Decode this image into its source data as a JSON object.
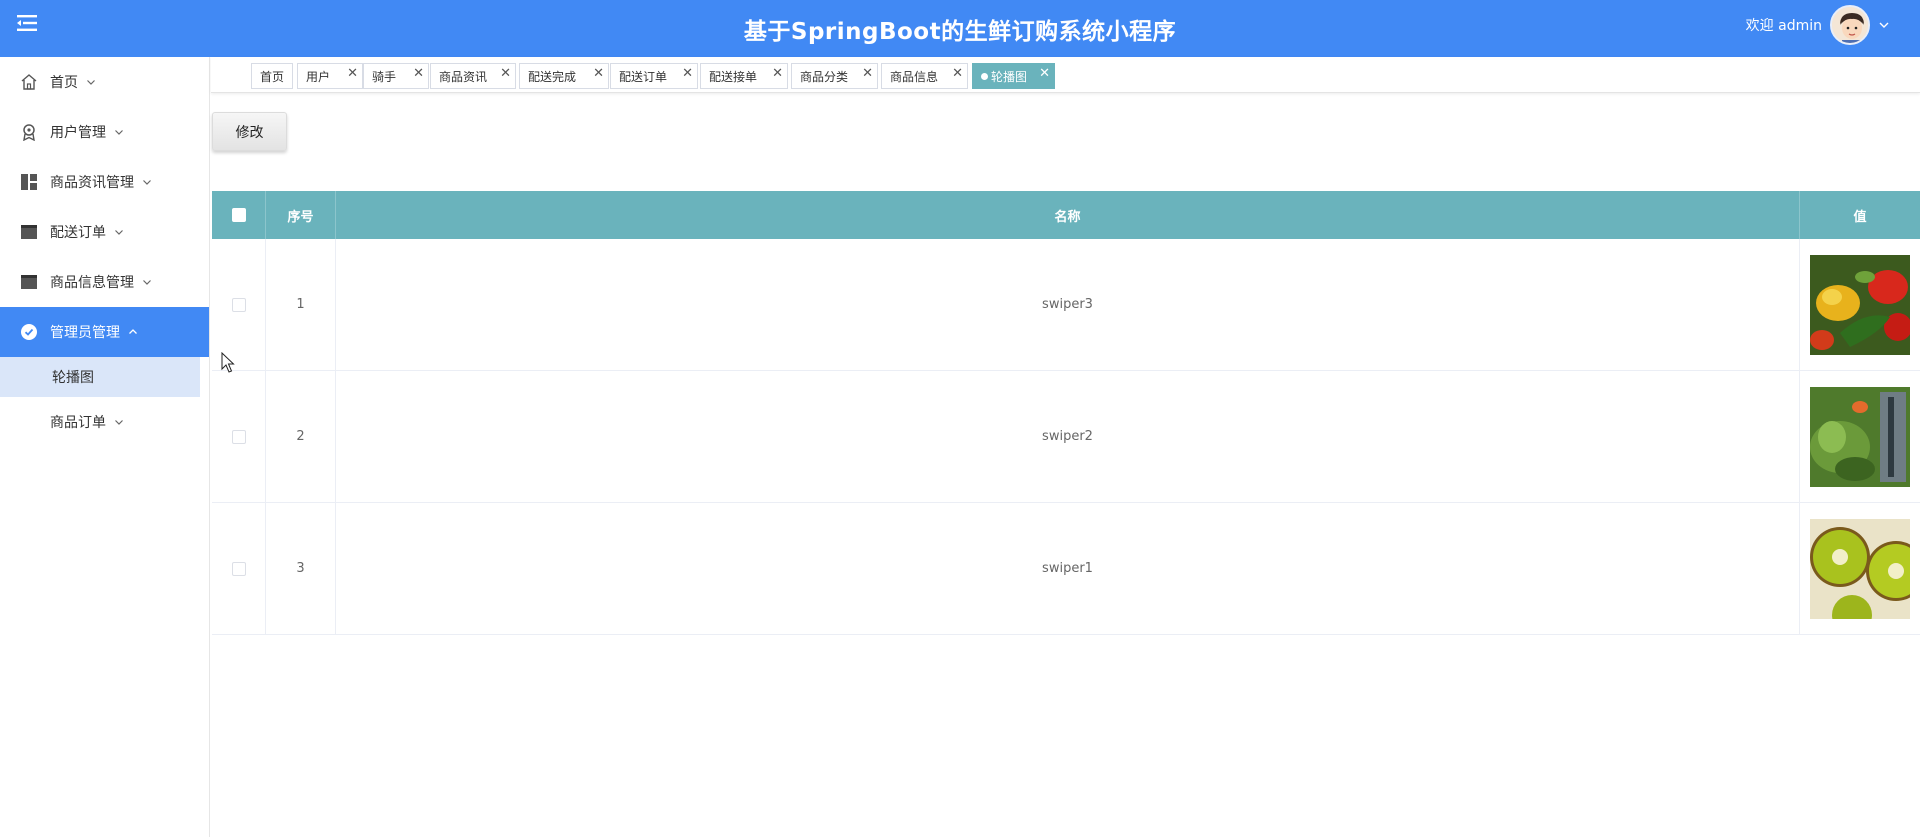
{
  "header": {
    "title": "基于SpringBoot的生鲜订购系统小程序",
    "welcome": "欢迎 admin",
    "brand_color": "#4189f4"
  },
  "sidebar": {
    "items": [
      {
        "label": "首页",
        "icon": "home-icon"
      },
      {
        "label": "用户管理",
        "icon": "user-badge-icon"
      },
      {
        "label": "商品资讯管理",
        "icon": "dashboard-icon"
      },
      {
        "label": "配送订单",
        "icon": "table-icon"
      },
      {
        "label": "商品信息管理",
        "icon": "table-icon"
      },
      {
        "label": "管理员管理",
        "icon": "check-circle-icon",
        "active": true
      }
    ],
    "subitems": [
      {
        "label": "轮播图",
        "active": true
      },
      {
        "label": "商品订单"
      }
    ]
  },
  "tabs": [
    {
      "label": "首页"
    },
    {
      "label": "用户"
    },
    {
      "label": "骑手"
    },
    {
      "label": "商品资讯"
    },
    {
      "label": "配送完成"
    },
    {
      "label": "配送订单"
    },
    {
      "label": "配送接单"
    },
    {
      "label": "商品分类"
    },
    {
      "label": "商品信息"
    },
    {
      "label": "轮播图",
      "active": true
    }
  ],
  "toolbar": {
    "modify_label": "修改"
  },
  "table": {
    "header_color": "#6ab3bc",
    "columns": [
      "序号",
      "名称",
      "值"
    ],
    "rows": [
      {
        "index": "1",
        "name": "swiper3",
        "image": "vegetables-thumbnail"
      },
      {
        "index": "2",
        "name": "swiper2",
        "image": "greens-thumbnail"
      },
      {
        "index": "3",
        "name": "swiper1",
        "image": "kiwi-thumbnail"
      }
    ]
  }
}
